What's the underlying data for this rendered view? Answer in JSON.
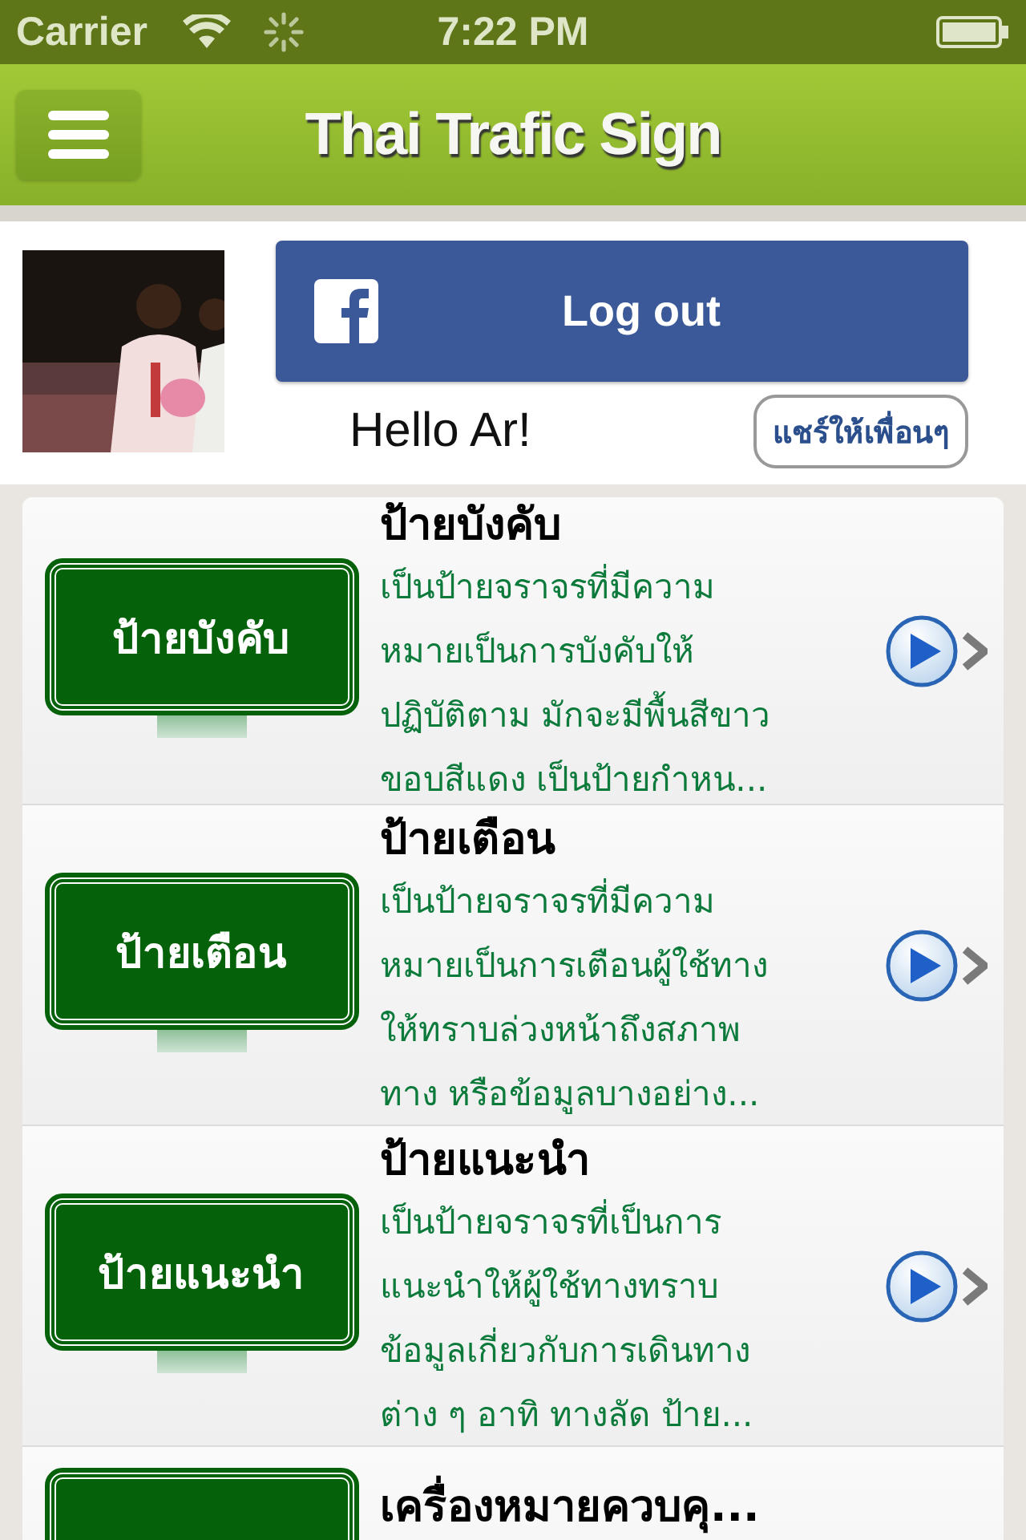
{
  "status_bar": {
    "carrier": "Carrier",
    "time": "7:22 PM"
  },
  "nav_bar": {
    "title": "Thai Trafic Sign"
  },
  "profile": {
    "logout_button": "Log out",
    "greeting": "Hello Ar!",
    "share_button": "แชร์ให้เพื่อนๆ"
  },
  "signs": [
    {
      "sign_label": "ป้ายบังคับ",
      "title": "ป้ายบังคับ",
      "description": "เป็นป้ายจราจรที่มีความ\nหมายเป็นการบังคับให้\nปฏิบัติตาม มักจะมีพื้นสีขาว\nขอบสีแดง เป็นป้ายกำหน..."
    },
    {
      "sign_label": "ป้ายเตือน",
      "title": "ป้ายเตือน",
      "description": "เป็นป้ายจราจรที่มีความ\nหมายเป็นการเตือนผู้ใช้ทาง\nให้ทราบล่วงหน้าถึงสภาพ\nทาง หรือข้อมูลบางอย่าง..."
    },
    {
      "sign_label": "ป้ายแนะนำ",
      "title": "ป้ายแนะนำ",
      "description": "เป็นป้ายจราจรที่เป็นการ\nแนะนำให้ผู้ใช้ทางทราบ\nข้อมูลเกี่ยวกับการเดินทาง\nต่าง ๆ อาทิ ทางลัด ป้าย..."
    },
    {
      "title": "เครื่องหมายควบคุ..."
    }
  ]
}
